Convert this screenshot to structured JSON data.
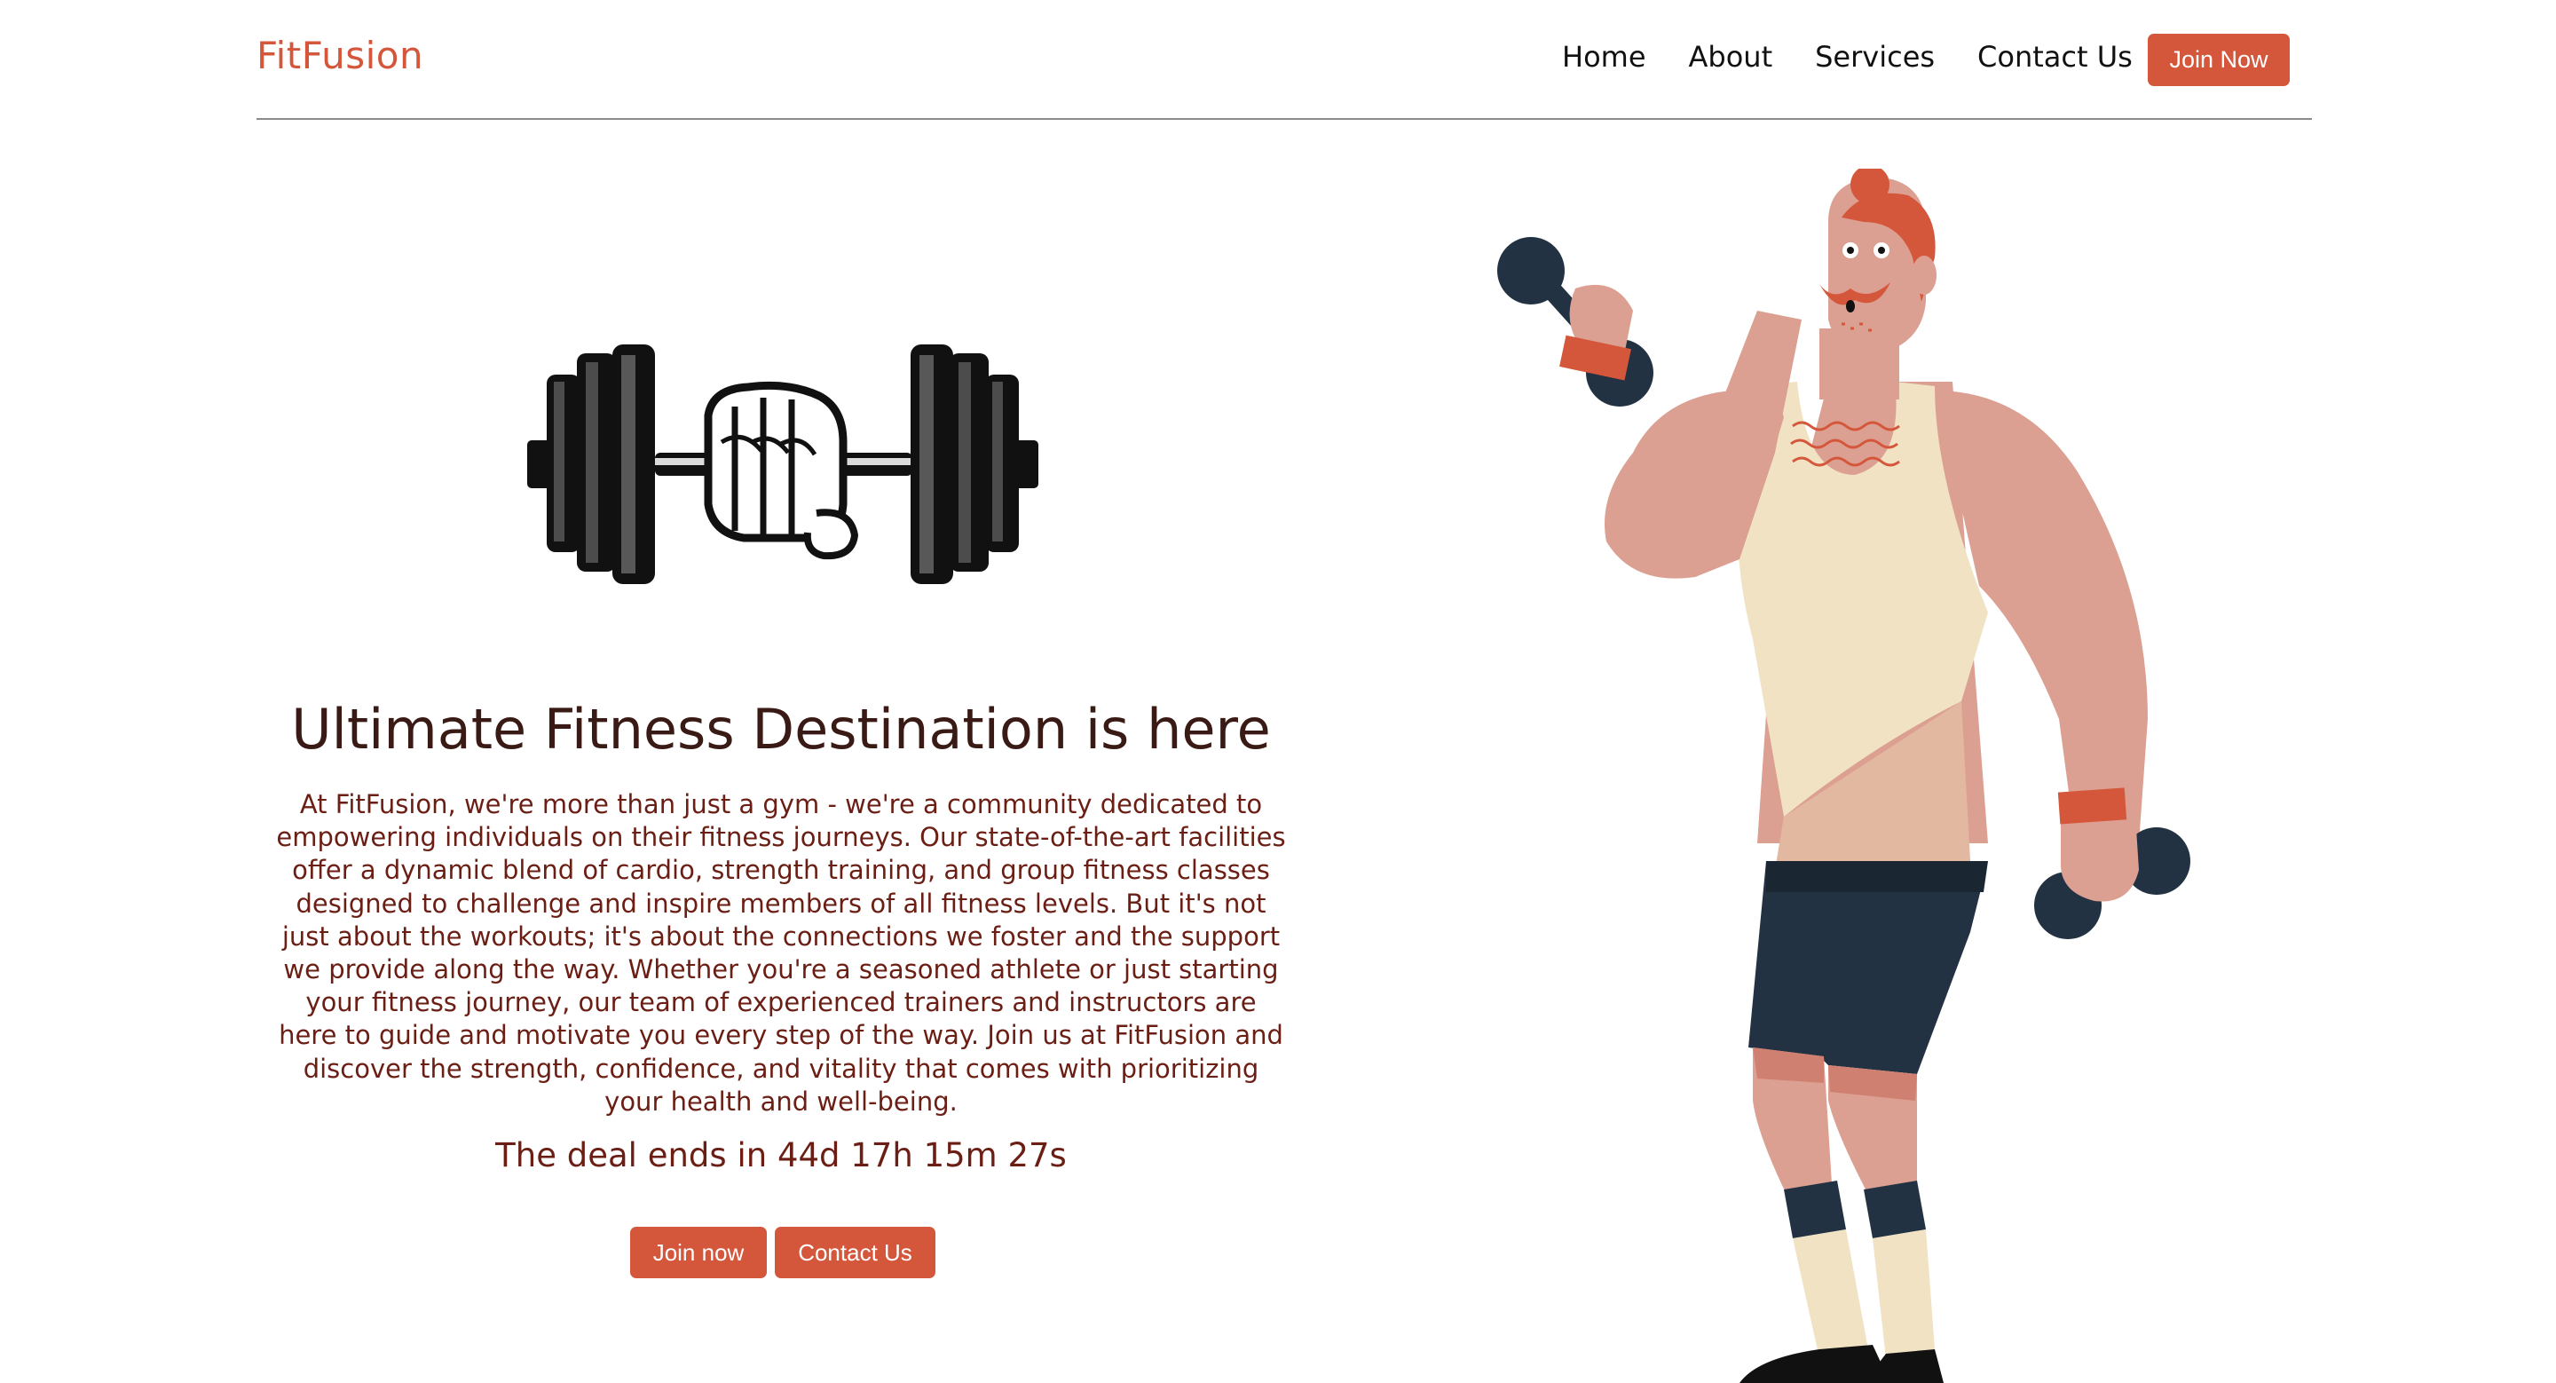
{
  "header": {
    "brand": "FitFusion",
    "nav": [
      "Home",
      "About",
      "Services",
      "Contact Us"
    ],
    "join_label": "Join Now"
  },
  "hero": {
    "title": "Ultimate Fitness Destination is here",
    "description": "At FitFusion, we're more than just a gym - we're a community dedicated to empowering individuals on their fitness journeys. Our state-of-the-art facilities offer a dynamic blend of cardio, strength training, and group fitness classes designed to challenge and inspire members of all fitness levels. But it's not just about the workouts; it's about the connections we foster and the support we provide along the way. Whether you're a seasoned athlete or just starting your fitness journey, our team of experienced trainers and instructors are here to guide and motivate you every step of the way. Join us at FitFusion and discover the strength, confidence, and vitality that comes with prioritizing your health and well-being.",
    "deal_text": "The deal ends in 44d 17h 15m 27s",
    "join_button": "Join now",
    "contact_button": "Contact Us"
  },
  "illustrations": {
    "logo_icon": "dumbbell-fist-icon",
    "hero_image": "muscleman-with-dumbbells-illustration"
  },
  "colors": {
    "accent": "#d5573b",
    "heading": "#3a1a14",
    "body_text": "#6b1e14"
  }
}
